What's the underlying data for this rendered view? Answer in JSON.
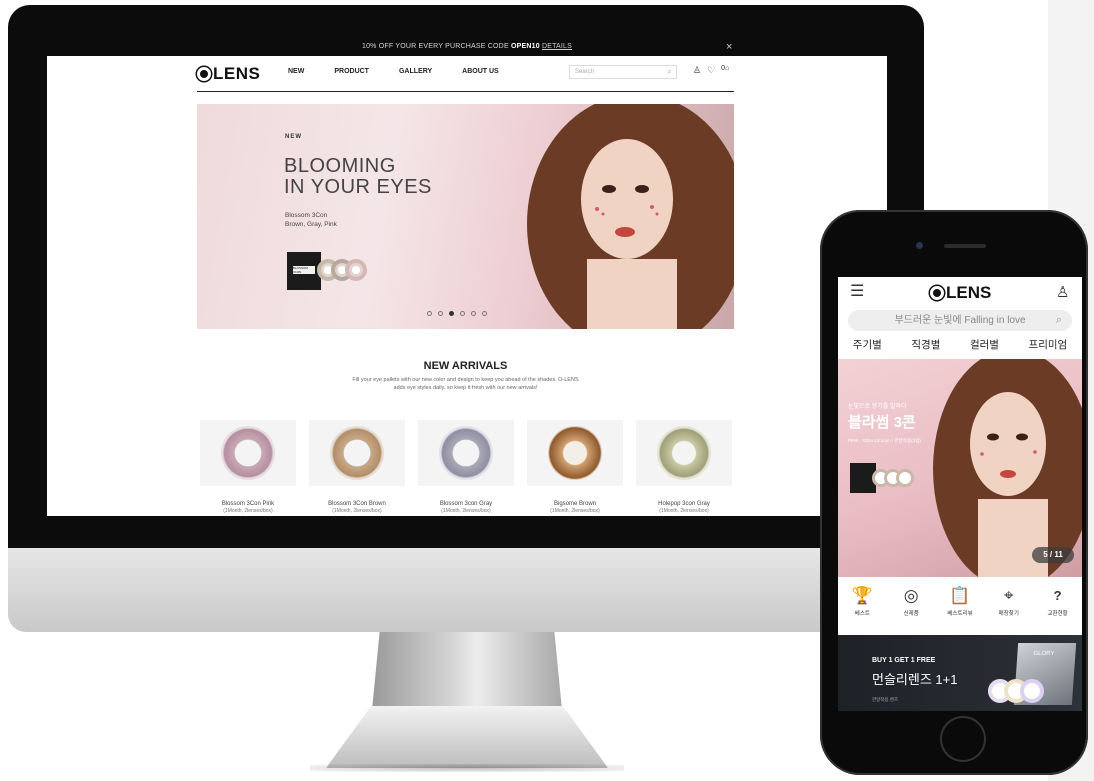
{
  "desktop": {
    "promo": {
      "text": "10% OFF YOUR EVERY PURCHASE CODE ",
      "code": "OPEN10",
      "link": "DETAILS",
      "close": "×"
    },
    "logo": "LENS",
    "nav": [
      "NEW",
      "PRODUCT",
      "GALLERY",
      "ABOUT US"
    ],
    "search_placeholder": "Search",
    "header_icons": {
      "account": "♙",
      "wishlist": "♡",
      "cart_count": "0",
      "cart": "🛍"
    },
    "hero": {
      "kicker": "NEW",
      "title_line1": "BLOOMING",
      "title_line2": "IN YOUR EYES",
      "product": "Blossom 3Con",
      "colors": "Brown, Gray, Pink",
      "box_label": "BLOSSOM 3CON",
      "slides": 6,
      "active_slide": 3
    },
    "arrivals": {
      "title": "NEW ARRIVALS",
      "description": "Fill your eye pallets with our new color and design to keep you ahead of the shades. O-LENS adds eye styles daily, so keep it fresh with our new arrivals!",
      "items": [
        {
          "name": "Blossom 3Con Pink",
          "sub": "(1Month, 2lenses/box)",
          "ring": "#c9a9b4"
        },
        {
          "name": "Blossom 3Con Brown",
          "sub": "(1Month, 2lenses/box)",
          "ring": "#c9a98a"
        },
        {
          "name": "Blossom 3con Gray",
          "sub": "(1Month, 2lenses/box)",
          "ring": "#a9a9b8"
        },
        {
          "name": "Bigsome Brown",
          "sub": "(1Month, 2lenses/box)",
          "ring": "#b07a48"
        },
        {
          "name": "Holepop 3con Gray",
          "sub": "(1Month, 2lenses/box)",
          "ring": "#b9b892"
        }
      ]
    }
  },
  "mobile": {
    "menu": "☰",
    "logo": "LENS",
    "user": "♙",
    "search_placeholder": "부드러운 눈빛에 Falling in love",
    "search_icon": "⌕",
    "tabs": [
      "주기별",
      "직경별",
      "컬러별",
      "프리미엄"
    ],
    "hero": {
      "pre": "눈빛으로 향기를 말하다",
      "title": "블라썸 3콘",
      "sub": "PINK · GDIA 13.1mm / 한달착용(2입)",
      "counter": "5 / 11"
    },
    "icons": [
      {
        "glyph": "🏆",
        "label": "베스트"
      },
      {
        "glyph": "◎",
        "label": "신제품"
      },
      {
        "glyph": "📋",
        "label": "베스트리뷰"
      },
      {
        "glyph": "⌖",
        "label": "매장찾기"
      },
      {
        "glyph": "?",
        "label": "교환현황"
      }
    ],
    "banner": {
      "kicker": "BUY 1 GET 1 FREE",
      "title": "먼슬리렌즈 1+1",
      "note": "한달착용 렌즈",
      "box_label": "GLORY"
    }
  }
}
